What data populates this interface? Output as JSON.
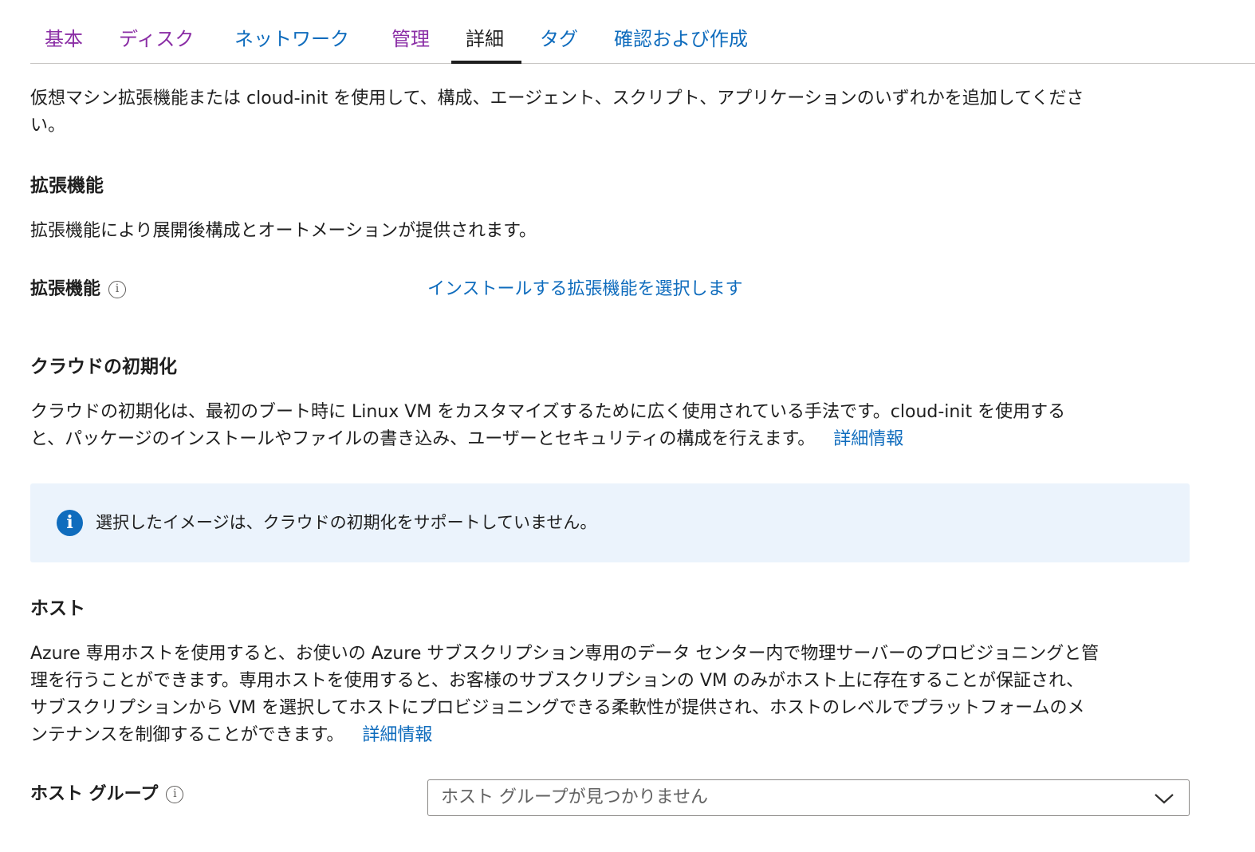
{
  "tabs": [
    {
      "label": "基本",
      "state": "visited"
    },
    {
      "label": "ディスク",
      "state": "visited"
    },
    {
      "label": "ネットワーク",
      "state": "link"
    },
    {
      "label": "管理",
      "state": "visited"
    },
    {
      "label": "詳細",
      "state": "active"
    },
    {
      "label": "タグ",
      "state": "link"
    },
    {
      "label": "確認および作成",
      "state": "link"
    }
  ],
  "intro": {
    "line1": "仮想マシン拡張機能または cloud-init を使用して、構成、エージェント、スクリプト、アプリケーションのいずれかを追加してくださ",
    "line2": "い。"
  },
  "extensions": {
    "heading": "拡張機能",
    "description": "拡張機能により展開後構成とオートメーションが提供されます。",
    "field_label": "拡張機能",
    "select_link": "インストールする拡張機能を選択します"
  },
  "cloud_init": {
    "heading": "クラウドの初期化",
    "line1": "クラウドの初期化は、最初のブート時に Linux VM をカスタマイズするために広く使用されている手法です。cloud-init を使用する",
    "line2": "と、パッケージのインストールやファイルの書き込み、ユーザーとセキュリティの構成を行えます。",
    "learn_more": "詳細情報",
    "notice": "選択したイメージは、クラウドの初期化をサポートしていません。"
  },
  "host": {
    "heading": "ホスト",
    "line1": "Azure 専用ホストを使用すると、お使いの Azure サブスクリプション専用のデータ センター内で物理サーバーのプロビジョニングと管",
    "line2": "理を行うことができます。専用ホストを使用すると、お客様のサブスクリプションの VM のみがホスト上に存在することが保証され、",
    "line3": "サブスクリプションから VM を選択してホストにプロビジョニングできる柔軟性が提供され、ホストのレベルでプラットフォームのメ",
    "line4": "ンテナンスを制御することができます。",
    "learn_more": "詳細情報",
    "group_label": "ホスト グループ",
    "group_placeholder": "ホスト グループが見つかりません"
  },
  "icons": {
    "info": "info-icon",
    "notice": "info-filled-icon",
    "chevron": "chevron-down-icon"
  },
  "colors": {
    "link": "#0f6cbd",
    "visited": "#8a2da5",
    "notice_bg": "#ebf3fc"
  }
}
